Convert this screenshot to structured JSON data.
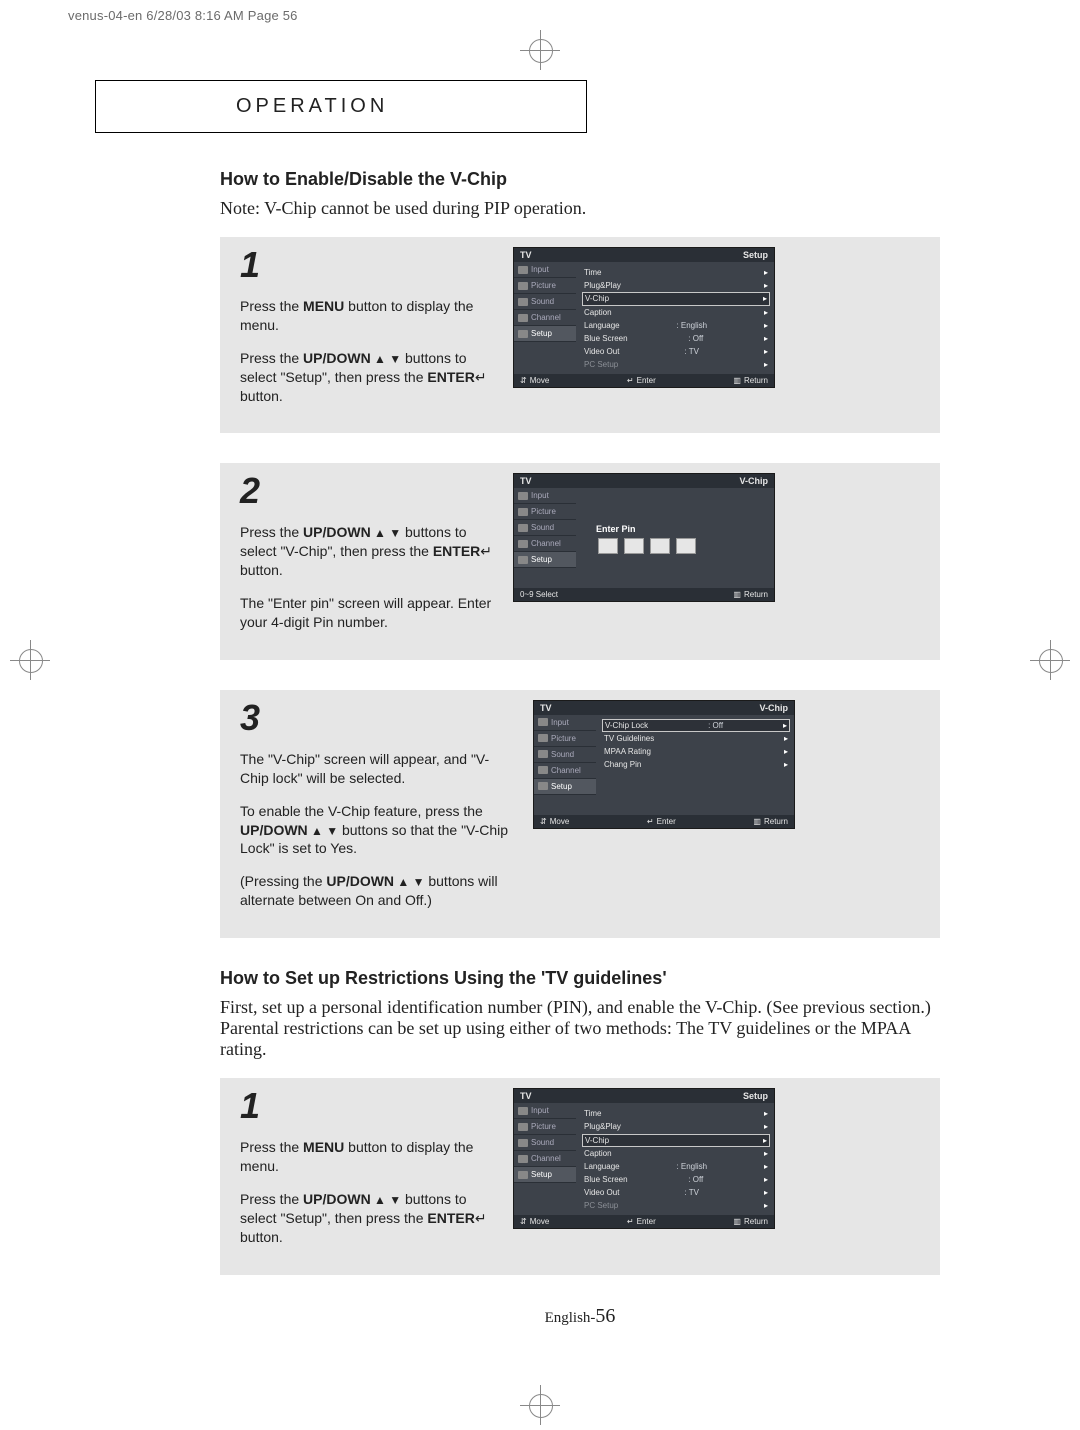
{
  "header_slug": "venus-04-en  6/28/03  8:16 AM  Page 56",
  "operation_label": "OPERATION",
  "section1": {
    "title": "How to Enable/Disable the V-Chip",
    "note": "Note: V-Chip cannot be used during PIP operation."
  },
  "steps": {
    "s1": {
      "num": "1",
      "p1a": "Press the ",
      "p1b": "MENU",
      "p1c": " button to display the menu.",
      "p2a": "Press the ",
      "p2b": "UP/DOWN",
      "p2arrows": " ▲ ▼",
      "p2c": " buttons to select \"Setup\", then press the ",
      "p2d": "ENTER",
      "p2icon": "↵",
      "p2e": " button."
    },
    "s2": {
      "num": "2",
      "p1a": "Press the ",
      "p1b": "UP/DOWN",
      "p1arrows": " ▲ ▼",
      "p1c": " buttons to select \"V-Chip\", then press the ",
      "p1d": "ENTER",
      "p1icon": "↵",
      "p1e": "   button.",
      "p2": "The \"Enter pin\" screen will appear. Enter your 4-digit Pin number."
    },
    "s3": {
      "num": "3",
      "p1": "The \"V-Chip\" screen will appear, and \"V-Chip lock\" will be selected.",
      "p2a": "To enable the V-Chip feature, press the ",
      "p2b": "UP/DOWN",
      "p2arrows": " ▲ ▼",
      "p2c": " buttons so that the \"V-Chip Lock\" is set to Yes.",
      "p3a": "(Pressing the ",
      "p3b": "UP/DOWN",
      "p3arrows": " ▲ ▼",
      "p3c": " buttons will alternate between On and Off.)"
    }
  },
  "section2": {
    "title": "How to Set up Restrictions Using the 'TV guidelines'",
    "note": "First, set up a personal identification number (PIN), and enable the V-Chip. (See previous section.) Parental restrictions can be set up using either of two methods: The TV guidelines or the MPAA rating."
  },
  "steps2": {
    "s1": {
      "num": "1",
      "p1a": "Press the ",
      "p1b": "MENU",
      "p1c": " button to display the menu.",
      "p2a": "Press the ",
      "p2b": "UP/DOWN",
      "p2arrows": " ▲ ▼",
      "p2c": " buttons to select \"Setup\", then press the ",
      "p2d": "ENTER",
      "p2icon": "↵",
      "p2e": " button."
    }
  },
  "osd_setup": {
    "title_left": "TV",
    "title_right": "Setup",
    "tabs": [
      "Input",
      "Picture",
      "Sound",
      "Channel",
      "Setup"
    ],
    "rows": [
      {
        "label": "Time",
        "val": "",
        "sel": false
      },
      {
        "label": "Plug&Play",
        "val": "",
        "sel": false
      },
      {
        "label": "V-Chip",
        "val": "",
        "sel": true
      },
      {
        "label": "Caption",
        "val": "",
        "sel": false
      },
      {
        "label": "Language",
        "val": ":   English",
        "sel": false
      },
      {
        "label": "Blue Screen",
        "val": ":   Off",
        "sel": false
      },
      {
        "label": "Video Out",
        "val": ":   TV",
        "sel": false
      },
      {
        "label": "PC Setup",
        "val": "",
        "sel": false,
        "dim": true
      }
    ],
    "footer": {
      "move": "Move",
      "enter": "Enter",
      "return": "Return"
    }
  },
  "osd_pin": {
    "title_left": "TV",
    "title_right": "V-Chip",
    "tabs": [
      "Input",
      "Picture",
      "Sound",
      "Channel",
      "Setup"
    ],
    "enter_pin": "Enter Pin",
    "footer": {
      "select": "0~9  Select",
      "return": "Return"
    }
  },
  "osd_vchip": {
    "title_left": "TV",
    "title_right": "V-Chip",
    "tabs": [
      "Input",
      "Picture",
      "Sound",
      "Channel",
      "Setup"
    ],
    "rows": [
      {
        "label": "V-Chip Lock",
        "val": ":   Off",
        "sel": true
      },
      {
        "label": "TV Guidelines",
        "val": "",
        "sel": false
      },
      {
        "label": "MPAA Rating",
        "val": "",
        "sel": false
      },
      {
        "label": "Chang Pin",
        "val": "",
        "sel": false
      }
    ],
    "footer": {
      "move": "Move",
      "enter": "Enter",
      "return": "Return"
    }
  },
  "page_number": {
    "prefix": "English-",
    "num": "56"
  }
}
